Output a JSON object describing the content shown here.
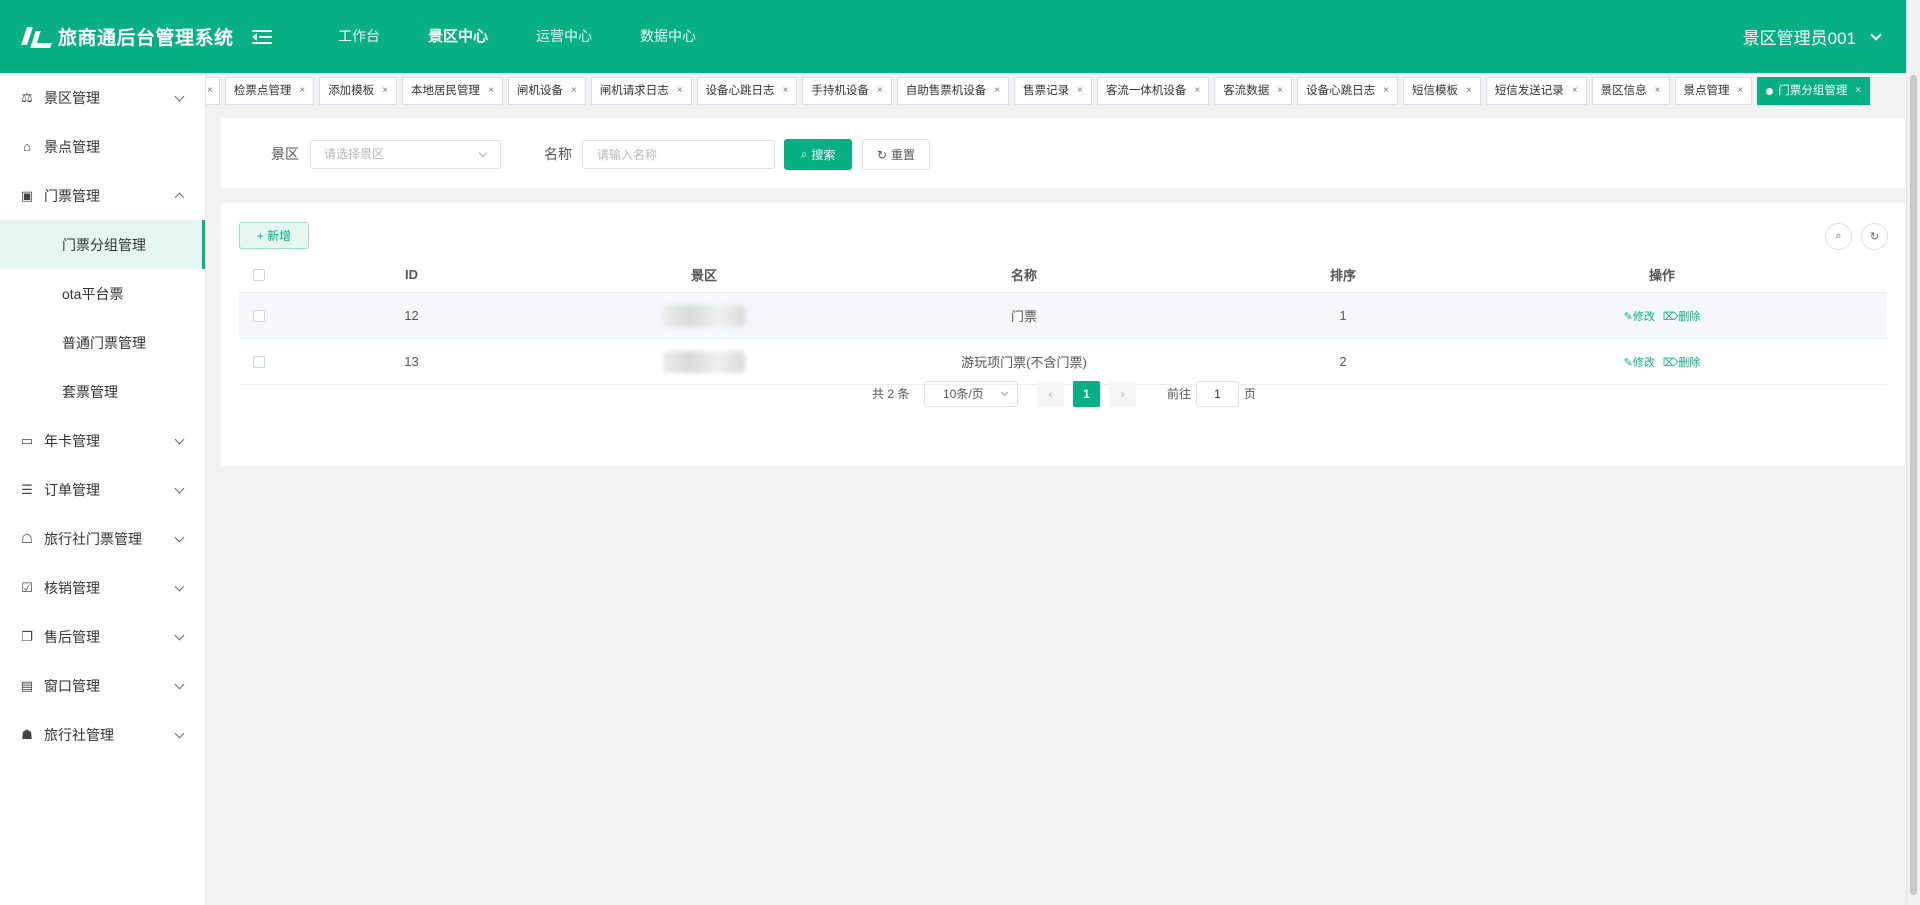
{
  "header": {
    "app_title": "旅商通后台管理系统",
    "nav": [
      "工作台",
      "景区中心",
      "运营中心",
      "数据中心"
    ],
    "active_nav": "景区中心",
    "user": "景区管理员001"
  },
  "sidebar": {
    "items": [
      {
        "label": "景区管理",
        "icon": "scenic-icon",
        "expandable": true
      },
      {
        "label": "景点管理",
        "icon": "spot-icon",
        "expandable": false
      },
      {
        "label": "门票管理",
        "icon": "ticket-icon",
        "expandable": true,
        "expanded": true,
        "children": [
          "门票分组管理",
          "ota平台票",
          "普通门票管理",
          "套票管理"
        ]
      },
      {
        "label": "年卡管理",
        "icon": "card-icon",
        "expandable": true
      },
      {
        "label": "订单管理",
        "icon": "order-icon",
        "expandable": true
      },
      {
        "label": "旅行社门票管理",
        "icon": "agency-ticket-icon",
        "expandable": true
      },
      {
        "label": "核销管理",
        "icon": "verify-icon",
        "expandable": true
      },
      {
        "label": "售后管理",
        "icon": "aftersale-icon",
        "expandable": true
      },
      {
        "label": "窗口管理",
        "icon": "window-icon",
        "expandable": true
      },
      {
        "label": "旅行社管理",
        "icon": "bank-icon",
        "expandable": true
      }
    ],
    "active_child": "门票分组管理"
  },
  "tabs": {
    "items": [
      "检票点管理",
      "添加模板",
      "本地居民管理",
      "闸机设备",
      "闸机请求日志",
      "设备心跳日志",
      "手持机设备",
      "自助售票机设备",
      "售票记录",
      "客流一体机设备",
      "客流数据",
      "设备心跳日志",
      "短信模板",
      "短信发送记录",
      "景区信息",
      "景点管理",
      "门票分组管理"
    ],
    "active": "门票分组管理",
    "close_glyph": "×"
  },
  "search": {
    "scenic_label": "景区",
    "scenic_placeholder": "请选择景区",
    "name_label": "名称",
    "name_placeholder": "请输入名称",
    "search_button": "搜索",
    "reset_button": "重置"
  },
  "table": {
    "add_button": "新增",
    "columns": [
      "ID",
      "景区",
      "名称",
      "排序",
      "操作"
    ],
    "rows": [
      {
        "id": "12",
        "scenic": "",
        "name": "门票",
        "sort": "1"
      },
      {
        "id": "13",
        "scenic": "",
        "name": "游玩项门票(不含门票)",
        "sort": "2"
      }
    ],
    "edit_label": "修改",
    "delete_label": "删除"
  },
  "pagination": {
    "total": "共 2 条",
    "page_size": "10条/页",
    "current_page": "1",
    "goto_label": "前往",
    "goto_value": "1",
    "page_unit": "页"
  },
  "colors": {
    "brand": "#07b083",
    "background": "#f2f2f2"
  }
}
